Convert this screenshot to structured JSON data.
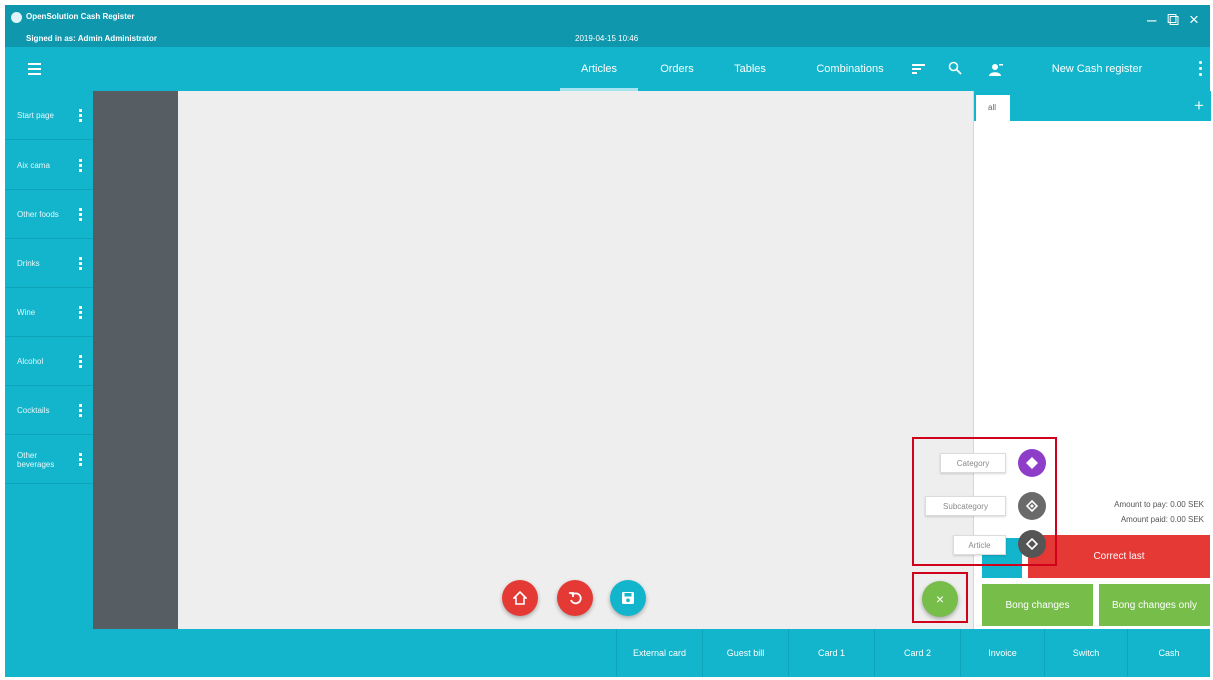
{
  "window": {
    "title": "OpenSolution Cash Register",
    "signed_in": "Signed in as: Admin Administrator",
    "datetime": "2019-04-15  10:46"
  },
  "toolbar": {
    "tabs": [
      {
        "label": "Articles",
        "active": true
      },
      {
        "label": "Orders"
      },
      {
        "label": "Tables"
      },
      {
        "label": "Combinations"
      }
    ],
    "register_name": "New Cash register"
  },
  "sidebar": {
    "categories": [
      {
        "label": "Start page"
      },
      {
        "label": "Aix cama"
      },
      {
        "label": "Other foods"
      },
      {
        "label": "Drinks"
      },
      {
        "label": "Wine"
      },
      {
        "label": "Alcohol"
      },
      {
        "label": "Cocktails"
      },
      {
        "label": "Other beverages"
      }
    ]
  },
  "receipt": {
    "tab_all": "all",
    "amount_to_pay": "Amount to pay: 0.00 SEK",
    "amount_paid": "Amount paid: 0.00 SEK",
    "correct_last": "Correct last",
    "bong_changes": "Bong changes",
    "bong_changes_only": "Bong changes only"
  },
  "speed_dial": {
    "category": "Category",
    "subcategory": "Subcategory",
    "article": "Article",
    "close_symbol": "×"
  },
  "payment": {
    "buttons": [
      "External card",
      "Guest bill",
      "Card 1",
      "Card 2",
      "Invoice",
      "Switch",
      "Cash"
    ]
  },
  "colors": {
    "primary": "#12b5cb",
    "titlebar": "#0e97ad",
    "danger": "#e53935",
    "success": "#76bd4a",
    "category_fab": "#8e3dc9",
    "highlight": "#d0021b"
  }
}
